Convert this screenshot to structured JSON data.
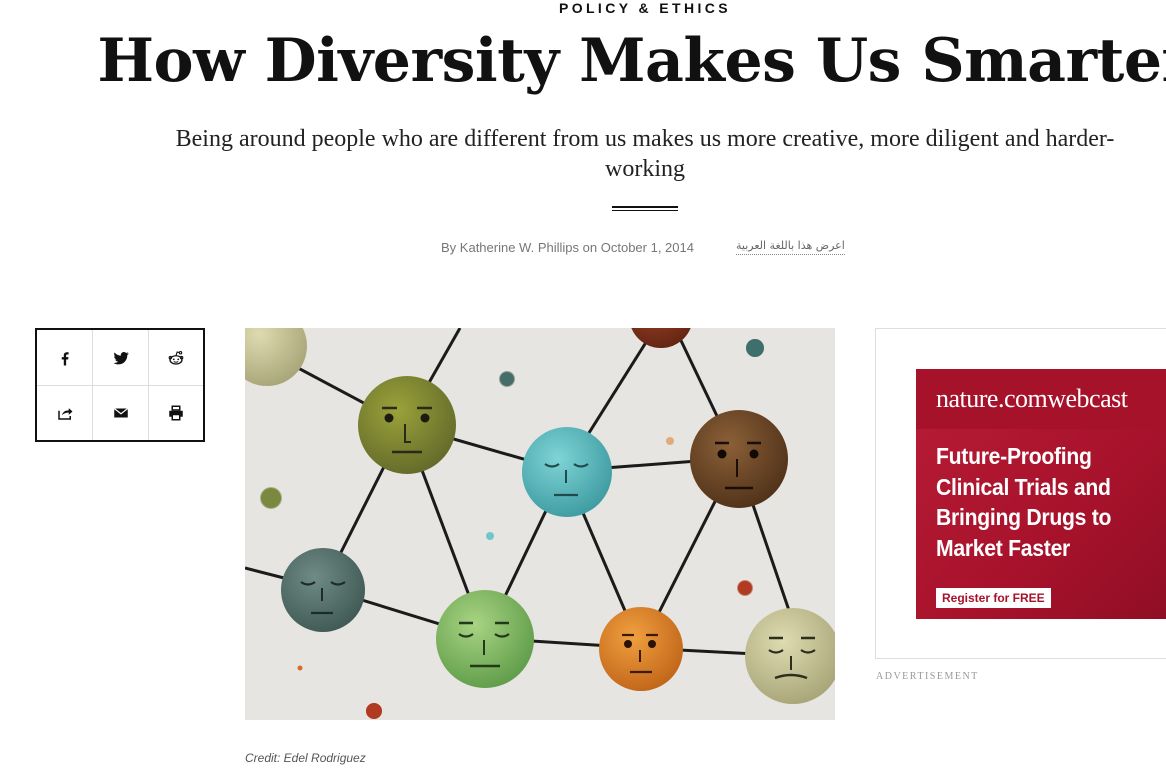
{
  "article": {
    "kicker": "POLICY & ETHICS",
    "title": "How Diversity Makes Us Smarter",
    "dek": "Being around people who are different from us makes us more creative, more diligent and harder-working",
    "byline_prefix": "By",
    "author": "Katherine W. Phillips",
    "date_prefix": "on",
    "date": "October 1, 2014",
    "arabic_link": "اعرض هذا باللغة العربية",
    "image_credit": "Credit: Edel Rodriguez"
  },
  "share": {
    "items": [
      {
        "name": "facebook-icon"
      },
      {
        "name": "twitter-icon"
      },
      {
        "name": "reddit-icon"
      },
      {
        "name": "share-icon"
      },
      {
        "name": "email-icon"
      },
      {
        "name": "print-icon"
      }
    ]
  },
  "ad": {
    "logo_main": "nature.com",
    "logo_thin": "webcast",
    "headline_lines": [
      "Future-Proofing",
      "Clinical Trials and",
      "Bringing Drugs to",
      "Market Faster"
    ],
    "cta": "Register for FREE",
    "label": "ADVERTISEMENT"
  },
  "colors": {
    "ad_red": "#a7122b",
    "text": "#111111",
    "meta_gray": "#777777"
  }
}
